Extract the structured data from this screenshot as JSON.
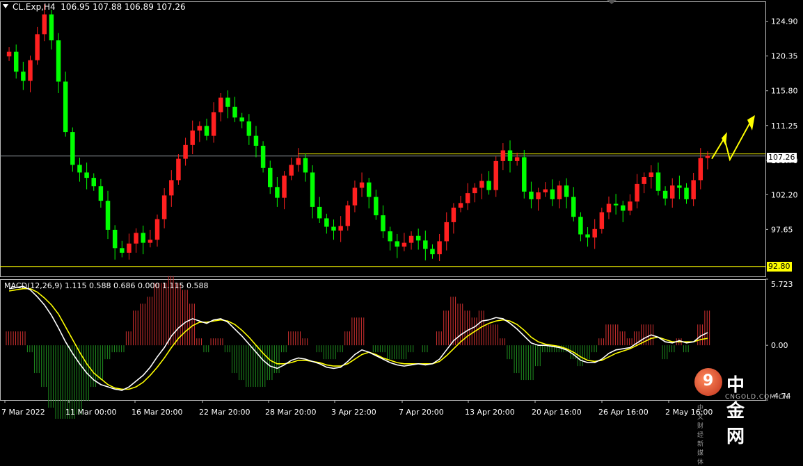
{
  "header": {
    "symbol": "CL.Exp,H4",
    "ohlc": "106.95 107.88 106.89 107.26"
  },
  "price_axis": [
    "124.90",
    "120.35",
    "115.80",
    "111.25",
    "106.70",
    "102.20",
    "97.65"
  ],
  "price_markers": {
    "current": "107.26",
    "support": "92.80"
  },
  "macd": {
    "label": "MACD(12,26,9) 1.115 0.588 0.686 0.000 1.115 0.588",
    "axis_top": "5.723",
    "axis_zero": "0.00",
    "axis_bottom": "-4.74"
  },
  "time_axis": [
    "7 Mar 2022",
    "11 Mar 00:00",
    "16 Mar 20:00",
    "22 Mar 20:00",
    "28 Mar 20:00",
    "3 Apr 22:00",
    "7 Apr 20:00",
    "13 Apr 20:00",
    "20 Apr 16:00",
    "26 Apr 16:00",
    "2 May 16:00"
  ],
  "watermark": {
    "glyph": "9",
    "name": "中金网",
    "url": "CNGOLD.COM.CN",
    "tagline": "中文财经新媒体"
  },
  "colors": {
    "bull": "#ff2020",
    "bear": "#00ff00",
    "grid": "#444444",
    "level": "#ffff00",
    "macd_line": "#ffffff",
    "signal_line": "#ffff00",
    "hist_pos": "#d03030",
    "hist_neg": "#1f8f1f"
  },
  "chart_data": {
    "type": "candlestick",
    "title": "CL.Exp,H4",
    "ylim": [
      91.5,
      127.5
    ],
    "closes": [
      120.9,
      118.3,
      117.1,
      119.8,
      123.2,
      125.8,
      122.4,
      117.0,
      110.4,
      106.1,
      105.1,
      104.4,
      103.3,
      101.4,
      97.6,
      95.2,
      94.6,
      95.8,
      97.2,
      95.9,
      96.3,
      99.0,
      102.1,
      104.1,
      106.9,
      108.7,
      110.6,
      111.2,
      109.9,
      113.0,
      114.9,
      113.7,
      112.3,
      111.8,
      109.9,
      108.6,
      105.7,
      103.2,
      101.8,
      104.7,
      106.1,
      107.0,
      105.1,
      100.6,
      99.1,
      98.0,
      97.5,
      98.1,
      100.8,
      103.1,
      103.8,
      101.9,
      99.5,
      97.4,
      96.1,
      95.4,
      95.9,
      96.8,
      96.2,
      95.1,
      94.4,
      96.1,
      98.6,
      100.5,
      101.1,
      102.4,
      103.1,
      104.0,
      102.8,
      106.6,
      108.0,
      106.6,
      107.1,
      102.6,
      101.6,
      102.5,
      102.9,
      101.6,
      103.4,
      101.9,
      99.3,
      97.0,
      96.6,
      97.7,
      99.9,
      101.0,
      100.8,
      100.1,
      101.3,
      103.6,
      104.5,
      105.1,
      102.7,
      101.7,
      103.4,
      103.1,
      101.6,
      104.1,
      107.0,
      107.3
    ],
    "macd": [
      4.9,
      5.0,
      5.1,
      4.8,
      4.2,
      3.5,
      2.6,
      1.5,
      0.3,
      -0.7,
      -1.6,
      -2.4,
      -3.0,
      -3.4,
      -3.6,
      -3.8,
      -3.9,
      -3.6,
      -3.1,
      -2.6,
      -1.9,
      -1.0,
      -0.2,
      0.8,
      1.5,
      2.0,
      2.3,
      2.1,
      1.9,
      2.2,
      2.3,
      2.0,
      1.4,
      0.8,
      0.1,
      -0.6,
      -1.3,
      -1.8,
      -2.0,
      -1.7,
      -1.3,
      -1.1,
      -1.2,
      -1.4,
      -1.6,
      -1.9,
      -2.0,
      -1.9,
      -1.4,
      -0.8,
      -0.4,
      -0.6,
      -0.9,
      -1.2,
      -1.5,
      -1.7,
      -1.8,
      -1.7,
      -1.6,
      -1.7,
      -1.6,
      -1.2,
      -0.4,
      0.4,
      0.9,
      1.3,
      1.6,
      2.1,
      2.2,
      2.4,
      2.3,
      1.9,
      1.4,
      0.8,
      0.2,
      0.0,
      0.0,
      -0.1,
      -0.2,
      -0.4,
      -0.8,
      -1.3,
      -1.5,
      -1.5,
      -1.2,
      -0.7,
      -0.4,
      -0.3,
      -0.2,
      0.2,
      0.6,
      0.9,
      0.7,
      0.3,
      0.2,
      0.4,
      0.2,
      0.3,
      0.8,
      1.1
    ],
    "signal": [
      4.7,
      4.8,
      4.9,
      4.9,
      4.6,
      4.1,
      3.5,
      2.7,
      1.6,
      0.5,
      -0.6,
      -1.6,
      -2.4,
      -2.9,
      -3.4,
      -3.7,
      -3.8,
      -3.8,
      -3.6,
      -3.2,
      -2.6,
      -1.9,
      -1.1,
      -0.2,
      0.6,
      1.2,
      1.7,
      2.0,
      2.0,
      2.1,
      2.2,
      2.1,
      1.8,
      1.3,
      0.7,
      0.0,
      -0.7,
      -1.3,
      -1.6,
      -1.6,
      -1.5,
      -1.3,
      -1.3,
      -1.4,
      -1.5,
      -1.7,
      -1.8,
      -1.8,
      -1.6,
      -1.2,
      -0.8,
      -0.6,
      -0.8,
      -1.1,
      -1.3,
      -1.5,
      -1.6,
      -1.6,
      -1.6,
      -1.6,
      -1.6,
      -1.4,
      -0.9,
      -0.3,
      0.3,
      0.8,
      1.2,
      1.6,
      1.9,
      2.1,
      2.2,
      2.1,
      1.8,
      1.3,
      0.7,
      0.3,
      0.1,
      0.0,
      -0.1,
      -0.3,
      -0.6,
      -1.0,
      -1.3,
      -1.4,
      -1.3,
      -1.0,
      -0.7,
      -0.5,
      -0.3,
      0.0,
      0.3,
      0.6,
      0.7,
      0.5,
      0.3,
      0.3,
      0.3,
      0.3,
      0.5,
      0.6
    ],
    "horizontal_levels": [
      107.26,
      92.8
    ]
  }
}
